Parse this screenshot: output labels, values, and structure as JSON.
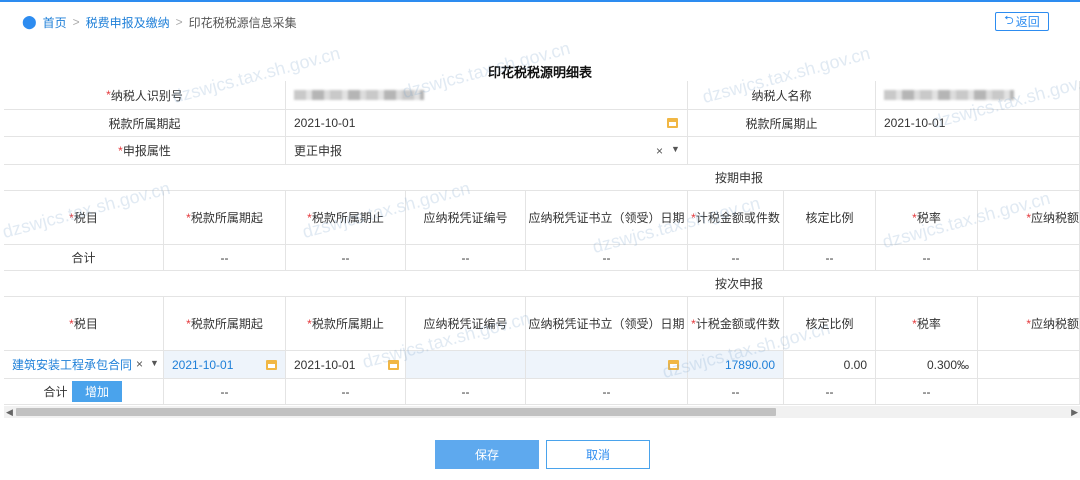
{
  "breadcrumb": {
    "home": "首页",
    "section": "税费申报及缴纳",
    "current": "印花税税源信息采集"
  },
  "back_label": "返回",
  "form_title": "印花税税源明细表",
  "info": {
    "taxpayer_id_label": "纳税人识别号",
    "taxpayer_name_label": "纳税人名称",
    "period_start_label": "税款所属期起",
    "period_start_value": "2021-10-01",
    "period_end_label": "税款所属期止",
    "period_end_value": "2021-10-01",
    "declare_attr_label": "申报属性",
    "declare_attr_value": "更正申报"
  },
  "periodic": {
    "section_title": "按期申报",
    "headers": [
      "税目",
      "税款所属期起",
      "税款所属期止",
      "应纳税凭证编号",
      "应纳税凭证书立（领受）日期",
      "计税金额或件数",
      "核定比例",
      "税率",
      "应纳税额"
    ],
    "total_row": [
      "合计",
      "--",
      "--",
      "--",
      "--",
      "--",
      "--",
      "--"
    ]
  },
  "per_event": {
    "section_title": "按次申报",
    "headers": [
      "税目",
      "税款所属期起",
      "税款所属期止",
      "应纳税凭证编号",
      "应纳税凭证书立（领受）日期",
      "计税金额或件数",
      "核定比例",
      "税率",
      "应纳税额"
    ],
    "row": {
      "tax_item": "建筑安装工程承包合同",
      "period_start": "2021-10-01",
      "period_end": "2021-10-01",
      "amount": "17890.00",
      "ratio": "0.00",
      "rate": "0.300‰"
    },
    "total_row": [
      "合计",
      "--",
      "--",
      "--",
      "--",
      "--",
      "--",
      "--"
    ],
    "add_label": "增加"
  },
  "actions": {
    "save": "保存",
    "cancel": "取消"
  },
  "watermark": "dzswjcs.tax.sh.gov.cn",
  "colors": {
    "accent": "#2d8cf0",
    "required": "#e4393c"
  }
}
